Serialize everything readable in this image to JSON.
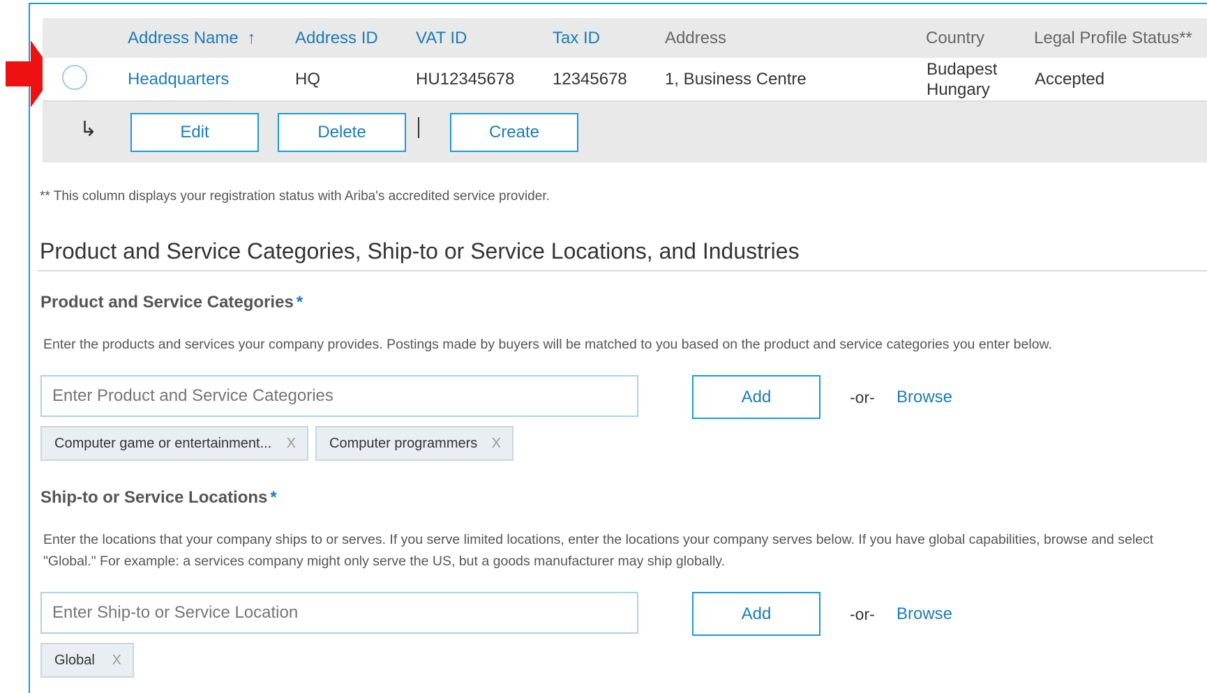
{
  "table": {
    "headers": {
      "address_name": "Address Name",
      "sort_indicator": "↑",
      "address_id": "Address ID",
      "vat_id": "VAT ID",
      "tax_id": "Tax ID",
      "address": "Address",
      "country": "Country",
      "legal_status": "Legal Profile Status**"
    },
    "rows": [
      {
        "address_name": "Headquarters",
        "address_id": "HQ",
        "vat_id": "HU12345678",
        "tax_id": "12345678",
        "address": "1, Business Centre",
        "country_line1": "Budapest",
        "country_line2": "Hungary",
        "legal_status": "Accepted"
      }
    ],
    "actions": {
      "corner_icon": "↳",
      "edit": "Edit",
      "delete": "Delete",
      "create": "Create"
    },
    "footnote": "** This column displays your registration status with Ariba's accredited service provider."
  },
  "section": {
    "title": "Product and Service Categories, Ship-to or Service Locations, and Industries"
  },
  "categories": {
    "heading": "Product and Service Categories",
    "required_mark": "*",
    "description": "Enter the products and services your company provides. Postings made by buyers will be matched to you based on the product and service categories you enter below.",
    "input_placeholder": "Enter Product and Service Categories",
    "add_label": "Add",
    "or_label": "-or-",
    "browse_label": "Browse",
    "chips": [
      {
        "label": "Computer game or entertainment...",
        "remove": "X"
      },
      {
        "label": "Computer programmers",
        "remove": "X"
      }
    ]
  },
  "locations": {
    "heading": "Ship-to or Service Locations",
    "required_mark": "*",
    "description_line1": "Enter the locations that your company ships to or serves. If you serve limited locations, enter the locations your company serves below. If you have global capabilities, browse and select",
    "description_line2": "\"Global.\" For example: a services company might only serve the US, but a goods manufacturer may ship globally.",
    "input_placeholder": "Enter Ship-to or Service Location",
    "add_label": "Add",
    "or_label": "-or-",
    "browse_label": "Browse",
    "chips": [
      {
        "label": "Global",
        "remove": "X"
      }
    ]
  },
  "colors": {
    "link": "#1a7cb8",
    "border_accent": "#1a9ad6",
    "annotation_arrow": "#ee1111",
    "header_bg": "#e9e9e9"
  }
}
